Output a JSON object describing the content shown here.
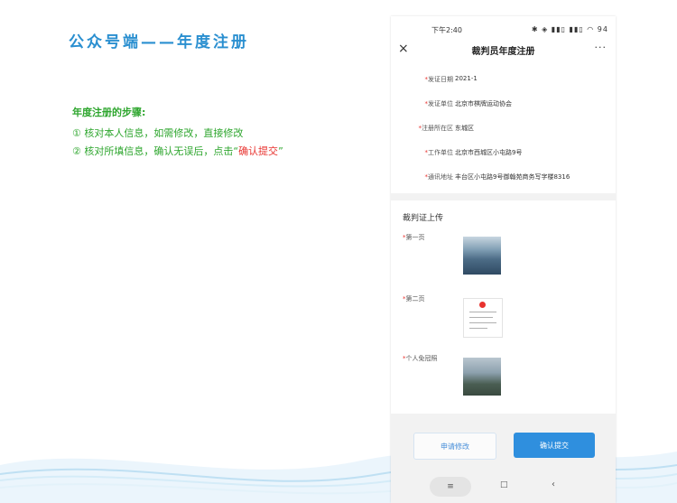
{
  "slide": {
    "title": "公众号端——年度注册",
    "steps_heading": "年度注册的步骤:",
    "steps": [
      "① 核对本人信息，如需修改，直接修改",
      "② 核对所填信息，确认无误后，点击“"
    ],
    "step2_highlight": "确认提交",
    "step2_tail": "”"
  },
  "phone": {
    "status": {
      "time": "下午2:40",
      "icons": "✱ ◈ ▮▮▯ ▮▮▯ ◠ 94"
    },
    "nav": {
      "close": "×",
      "title": "裁判员年度注册",
      "more": "···"
    },
    "fields": [
      {
        "label": "发证日期",
        "value": "2021-1"
      },
      {
        "label": "发证单位",
        "value": "北京市棋牌运动协会"
      },
      {
        "label": "注册所在区",
        "value": "东城区"
      },
      {
        "label": "工作单位",
        "value": "北京市西城区小屯路9号"
      },
      {
        "label": "通讯地址",
        "value": "丰台区小屯路9号御翰苑商务写字楼8316"
      }
    ],
    "required_mark": "*",
    "upload": {
      "title": "裁判证上传",
      "items": [
        "第一页",
        "第二页",
        "个人免冠照"
      ]
    },
    "buttons": {
      "apply_edit": "申请修改",
      "submit": "确认提交"
    },
    "sysnav": {
      "home": "≡",
      "square": "□",
      "back": "‹"
    }
  },
  "colors": {
    "title_blue": "#2a8fd0",
    "step_green": "#2ea62e",
    "highlight_red": "#e8332f",
    "primary_button": "#2f8fde"
  }
}
